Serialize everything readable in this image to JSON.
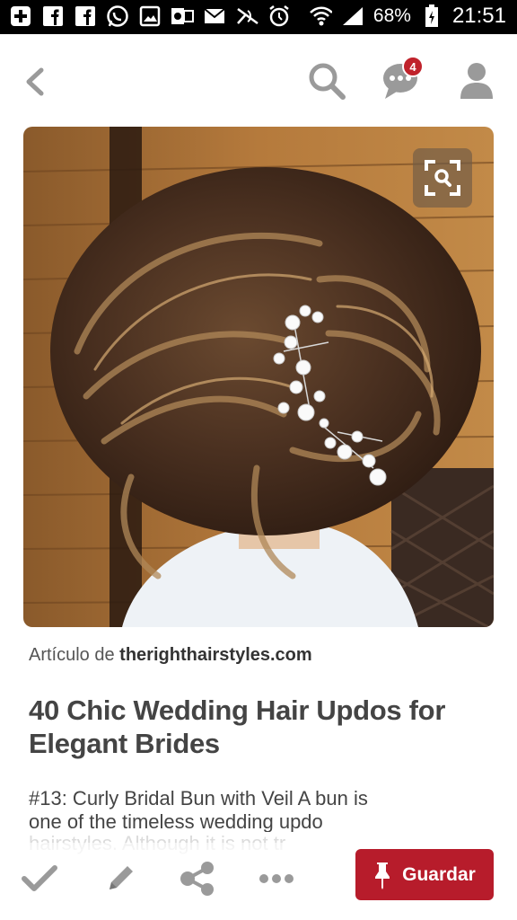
{
  "status_bar": {
    "battery": "68%",
    "time": "21:51"
  },
  "header": {
    "notification_count": "4"
  },
  "pin": {
    "article_prefix": "Artículo de ",
    "source": "therighthairstyles.com",
    "title": "40 Chic Wedding Hair Updos for Elegant Brides",
    "description": "#13: Curly Bridal Bun with Veil A bun is one of the timeless wedding updo",
    "description_faded": "hairstyles. Although it is not tr"
  },
  "actions": {
    "save_label": "Guardar"
  },
  "colors": {
    "accent": "#b71c2b",
    "badge": "#c0222b",
    "icon_gray": "#9a9a9a"
  }
}
